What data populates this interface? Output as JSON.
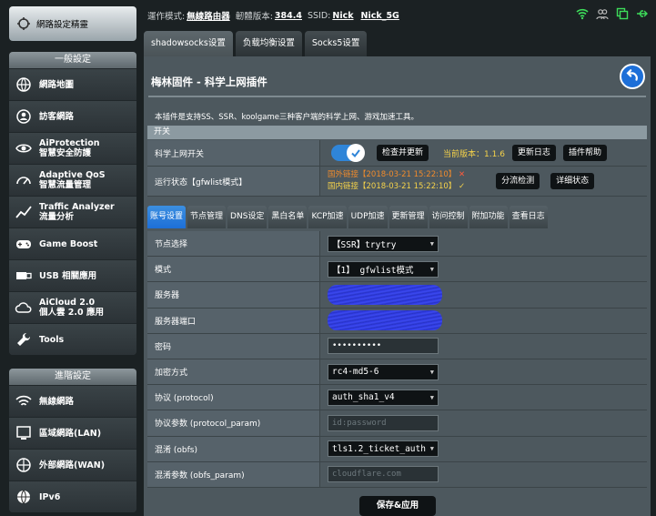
{
  "sidebar": {
    "wizard_label": "網路設定精靈",
    "general_header": "一般設定",
    "general_items": [
      {
        "icon": "globe-network-icon",
        "label": "網路地圖",
        "sub": ""
      },
      {
        "icon": "guest-network-icon",
        "label": "訪客網路",
        "sub": ""
      },
      {
        "icon": "shield-eye-icon",
        "label": "AiProtection",
        "sub": "智慧安全防護"
      },
      {
        "icon": "speedometer-icon",
        "label": "Adaptive QoS",
        "sub": "智慧流量管理"
      },
      {
        "icon": "traffic-graph-icon",
        "label": "Traffic Analyzer",
        "sub": "流量分析"
      },
      {
        "icon": "gamepad-icon",
        "label": "Game Boost",
        "sub": ""
      },
      {
        "icon": "usb-icon",
        "label": "USB 相關應用",
        "sub": ""
      },
      {
        "icon": "cloud-icon",
        "label": "AiCloud 2.0",
        "sub": "個人雲 2.0 應用"
      },
      {
        "icon": "wrench-icon",
        "label": "Tools",
        "sub": ""
      }
    ],
    "advanced_header": "進階設定",
    "advanced_items": [
      {
        "icon": "wireless-icon",
        "label": "無線網路"
      },
      {
        "icon": "lan-icon",
        "label": "區域網路(LAN)"
      },
      {
        "icon": "wan-globe-icon",
        "label": "外部網路(WAN)"
      },
      {
        "icon": "ipv6-globe-icon",
        "label": "IPv6"
      }
    ]
  },
  "topbar": {
    "mode_label": "運作模式:",
    "mode_value": "無線路由器",
    "firmware_label": "韌體版本:",
    "firmware_value": "384.4",
    "ssid_label": "SSID:",
    "ssid_1": "Nick",
    "ssid_2": "Nick_5G"
  },
  "tabs": [
    "shadowsocks设置",
    "负载均衡设置",
    "Socks5设置"
  ],
  "panel": {
    "title": "梅林固件 - 科学上网插件",
    "description": "本插件是支持SS、SSR、koolgame三种客户端的科学上网、游戏加速工具。",
    "section": "开关"
  },
  "switch_row": {
    "label": "科学上网开关",
    "check_update": "检查并更新",
    "version": "当前版本：1.1.6",
    "changelog": "更新日志",
    "help": "插件帮助"
  },
  "status_row": {
    "label": "运行状态【gfwlist模式】",
    "abroad": "国外链接【2018-03-21 15:22:10】",
    "abroad_mark": "✕",
    "domestic": "国内链接【2018-03-21 15:22:10】",
    "domestic_mark": "✓",
    "split_check": "分流检测",
    "detail": "详细状态"
  },
  "subtabs": [
    "账号设置",
    "节点管理",
    "DNS设定",
    "黑白名单",
    "KCP加速",
    "UDP加速",
    "更新管理",
    "访问控制",
    "附加功能",
    "查看日志"
  ],
  "form": [
    {
      "label": "节点选择",
      "type": "select",
      "value": "【SSR】trytry"
    },
    {
      "label": "模式",
      "type": "select",
      "value": "【1】 gfwlist模式"
    },
    {
      "label": "服务器",
      "type": "redacted",
      "value": ""
    },
    {
      "label": "服务器端口",
      "type": "redacted",
      "value": ""
    },
    {
      "label": "密码",
      "type": "input",
      "value": "••••••••••"
    },
    {
      "label": "加密方式",
      "type": "select",
      "value": "rc4-md5-6"
    },
    {
      "label": "协议 (protocol)",
      "type": "select",
      "value": "auth_sha1_v4"
    },
    {
      "label": "协议参数 (protocol_param)",
      "type": "placeholder",
      "value": "id:password"
    },
    {
      "label": "混淆 (obfs)",
      "type": "select",
      "value": "tls1.2_ticket_auth"
    },
    {
      "label": "混淆参数 (obfs_param)",
      "type": "placeholder",
      "value": "cloudflare.com"
    }
  ],
  "save_label": "保存&应用",
  "colors": {
    "accent": "#2f85d8",
    "version": "#f6d34a",
    "abroad": "#f08b2c",
    "error": "#ff5a3c"
  }
}
